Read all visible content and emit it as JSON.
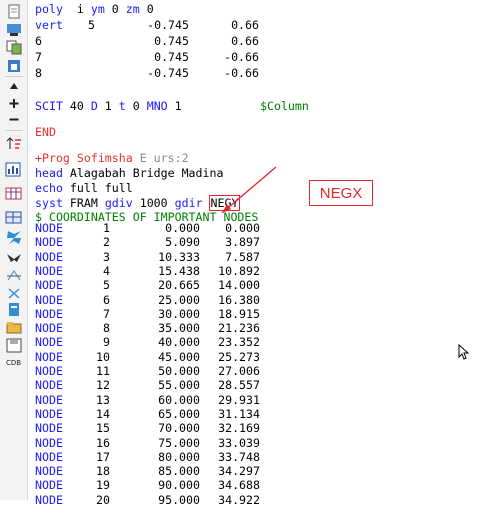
{
  "toolbar": {
    "icons": [
      "document-icon",
      "cut-icon",
      "copy-icon",
      "paste-icon",
      "bookmark-up-icon",
      "bookmark-add-icon",
      "bookmark-remove-icon",
      "sort-icon",
      "chart-icon",
      "table-icon",
      "butterfly-icon",
      "bird-icon",
      "structure-icon",
      "delete-icon",
      "file-tree-icon",
      "folder-open-icon",
      "save-icon",
      "cds-icon"
    ]
  },
  "code": {
    "l1": {
      "kw": "poly",
      "a": "  i ",
      "b": "ym",
      "c": " 0 ",
      "d": "zm",
      "e": " 0"
    },
    "l2": {
      "kw": "vert",
      "n": "5",
      "x": "-0.745",
      "y": "0.66"
    },
    "l3": {
      "n": "6",
      "x": "0.745",
      "y": "0.66"
    },
    "l4": {
      "n": "7",
      "x": "0.745",
      "y": "-0.66"
    },
    "l5": {
      "n": "8",
      "x": "-0.745",
      "y": "-0.66"
    },
    "l7": {
      "kw": "SCIT",
      "a": " 40 ",
      "b": "D",
      "c": " 1 ",
      "d": "t",
      "e": " 0 ",
      "f": "MNO",
      "g": " 1",
      "comment": "$Column"
    },
    "l9": {
      "kw": "END"
    },
    "l10": {
      "prog": "+Prog Sofimsha",
      "meta": " E urs:2"
    },
    "l11": {
      "kw": "head",
      "text": " Alagabah Bridge Madina"
    },
    "l12": {
      "kw": "echo",
      "text": " full full"
    },
    "l13": {
      "kw": "syst",
      "a": " FRAM ",
      "b": "gdiv",
      "c": " 1000 ",
      "d": "gdir",
      "e": "NEGY"
    },
    "l14": {
      "comment": "$ COORDINATES OF IMPORTANT NODES"
    }
  },
  "nodes": {
    "keyword": "NODE",
    "rows": [
      {
        "n": "1",
        "x": "0.000",
        "y": "0.000"
      },
      {
        "n": "2",
        "x": "5.090",
        "y": "3.897"
      },
      {
        "n": "3",
        "x": "10.333",
        "y": "7.587"
      },
      {
        "n": "4",
        "x": "15.438",
        "y": "10.892"
      },
      {
        "n": "5",
        "x": "20.665",
        "y": "14.000"
      },
      {
        "n": "6",
        "x": "25.000",
        "y": "16.380"
      },
      {
        "n": "7",
        "x": "30.000",
        "y": "18.915"
      },
      {
        "n": "8",
        "x": "35.000",
        "y": "21.236"
      },
      {
        "n": "9",
        "x": "40.000",
        "y": "23.352"
      },
      {
        "n": "10",
        "x": "45.000",
        "y": "25.273"
      },
      {
        "n": "11",
        "x": "50.000",
        "y": "27.006"
      },
      {
        "n": "12",
        "x": "55.000",
        "y": "28.557"
      },
      {
        "n": "13",
        "x": "60.000",
        "y": "29.931"
      },
      {
        "n": "14",
        "x": "65.000",
        "y": "31.134"
      },
      {
        "n": "15",
        "x": "70.000",
        "y": "32.169"
      },
      {
        "n": "16",
        "x": "75.000",
        "y": "33.039"
      },
      {
        "n": "17",
        "x": "80.000",
        "y": "33.748"
      },
      {
        "n": "18",
        "x": "85.000",
        "y": "34.297"
      },
      {
        "n": "19",
        "x": "90.000",
        "y": "34.688"
      },
      {
        "n": "20",
        "x": "95.000",
        "y": "34.922"
      }
    ]
  },
  "annotation": {
    "label": "NEGX",
    "color": "#e3262c"
  },
  "colors": {
    "keyword": "#1a1aff",
    "prog": "#e8322b",
    "comment": "#008000",
    "meta": "#8a8a8a"
  }
}
